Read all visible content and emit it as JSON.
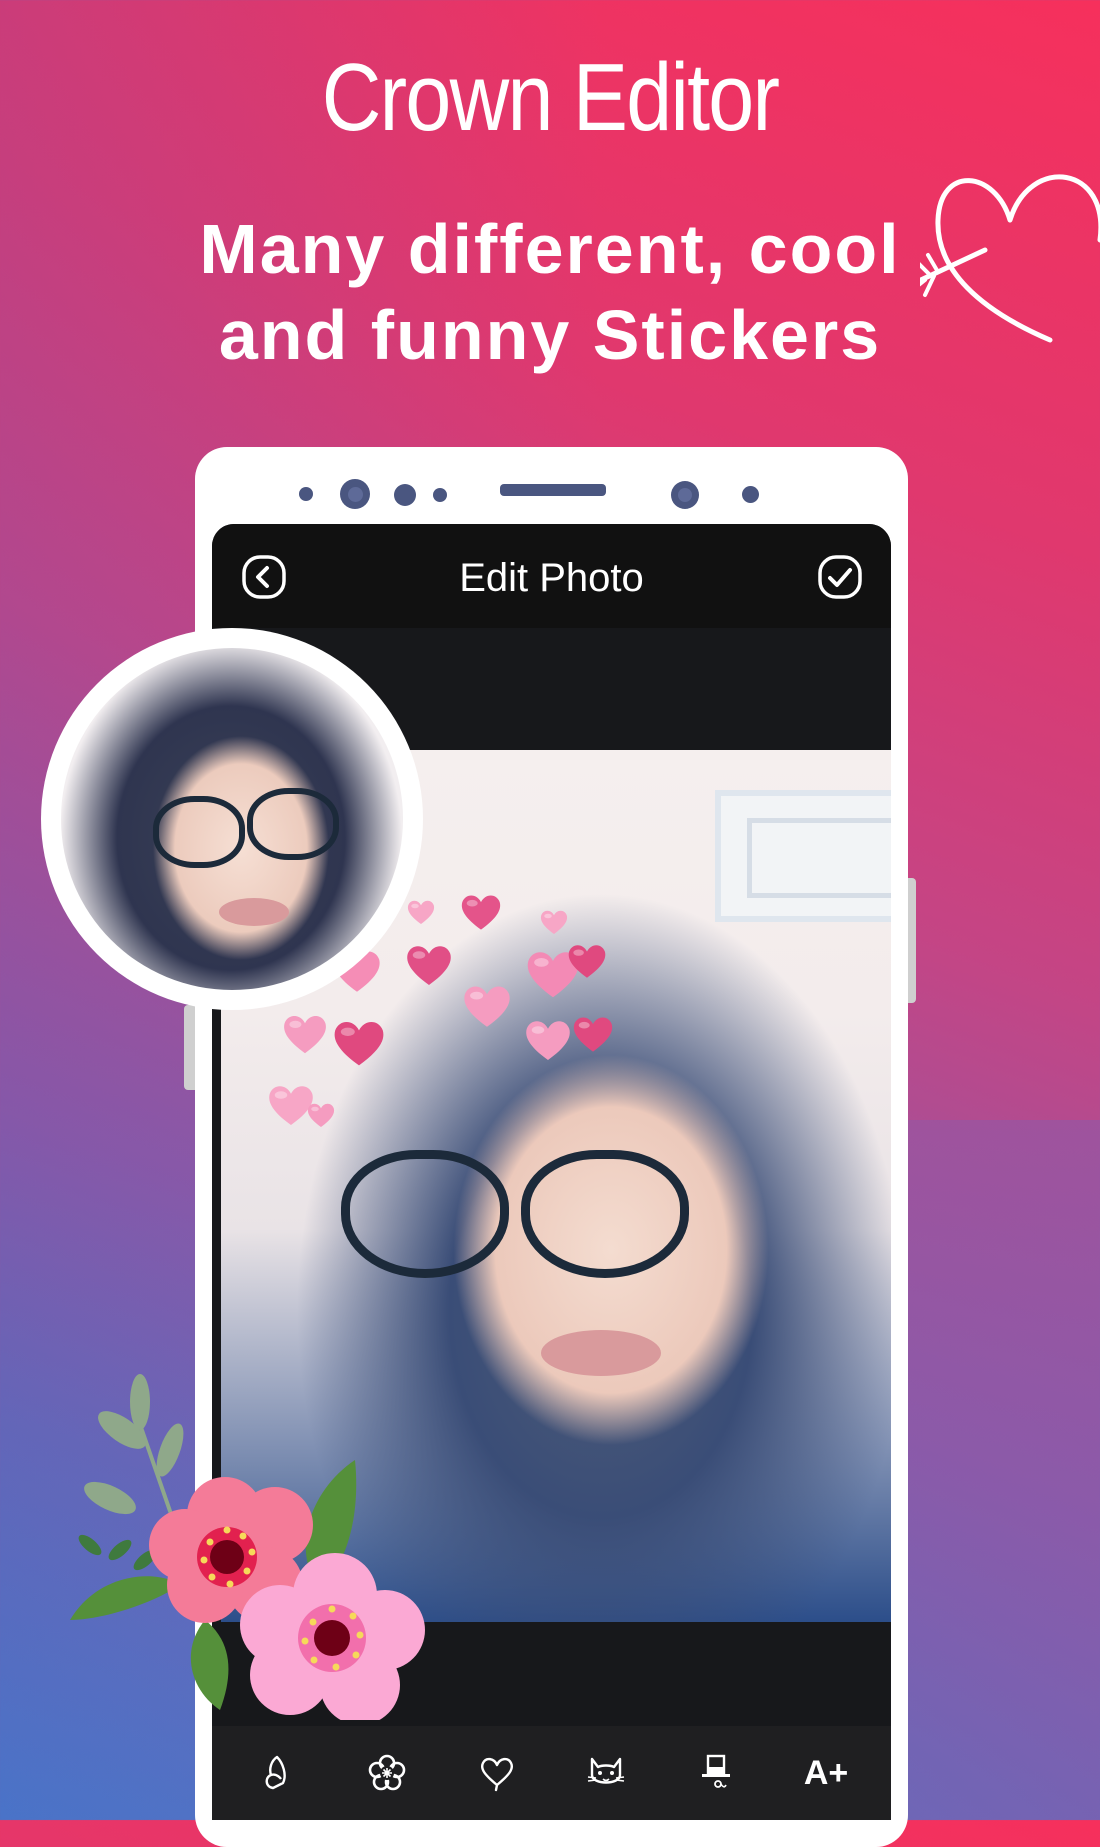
{
  "promo": {
    "title": "Crown Editor",
    "subtitle_line1": "Many different, cool",
    "subtitle_line2": "and funny Stickers"
  },
  "colors": {
    "background_top_right": "#f6305c",
    "background_bottom_left": "#3a7fd2",
    "background_bottom_right": "#8a5aa8",
    "phone_frame": "#ffffff",
    "sensor": "#4a5680",
    "appbar": "#111111",
    "canvas": "#17181b",
    "toolbar": "#1f1f21"
  },
  "app": {
    "header": {
      "title": "Edit Photo",
      "back_icon": "back-circle-icon",
      "confirm_icon": "check-circle-icon"
    },
    "toolbar": {
      "items": [
        {
          "name": "butterfly",
          "icon": "butterfly-icon"
        },
        {
          "name": "flower",
          "icon": "flower-icon"
        },
        {
          "name": "heart",
          "icon": "heart-icon"
        },
        {
          "name": "cat",
          "icon": "cat-icon"
        },
        {
          "name": "hat",
          "icon": "top-hat-icon"
        },
        {
          "name": "text",
          "label": "A+"
        }
      ]
    },
    "stickers_applied": "heart-crown"
  }
}
